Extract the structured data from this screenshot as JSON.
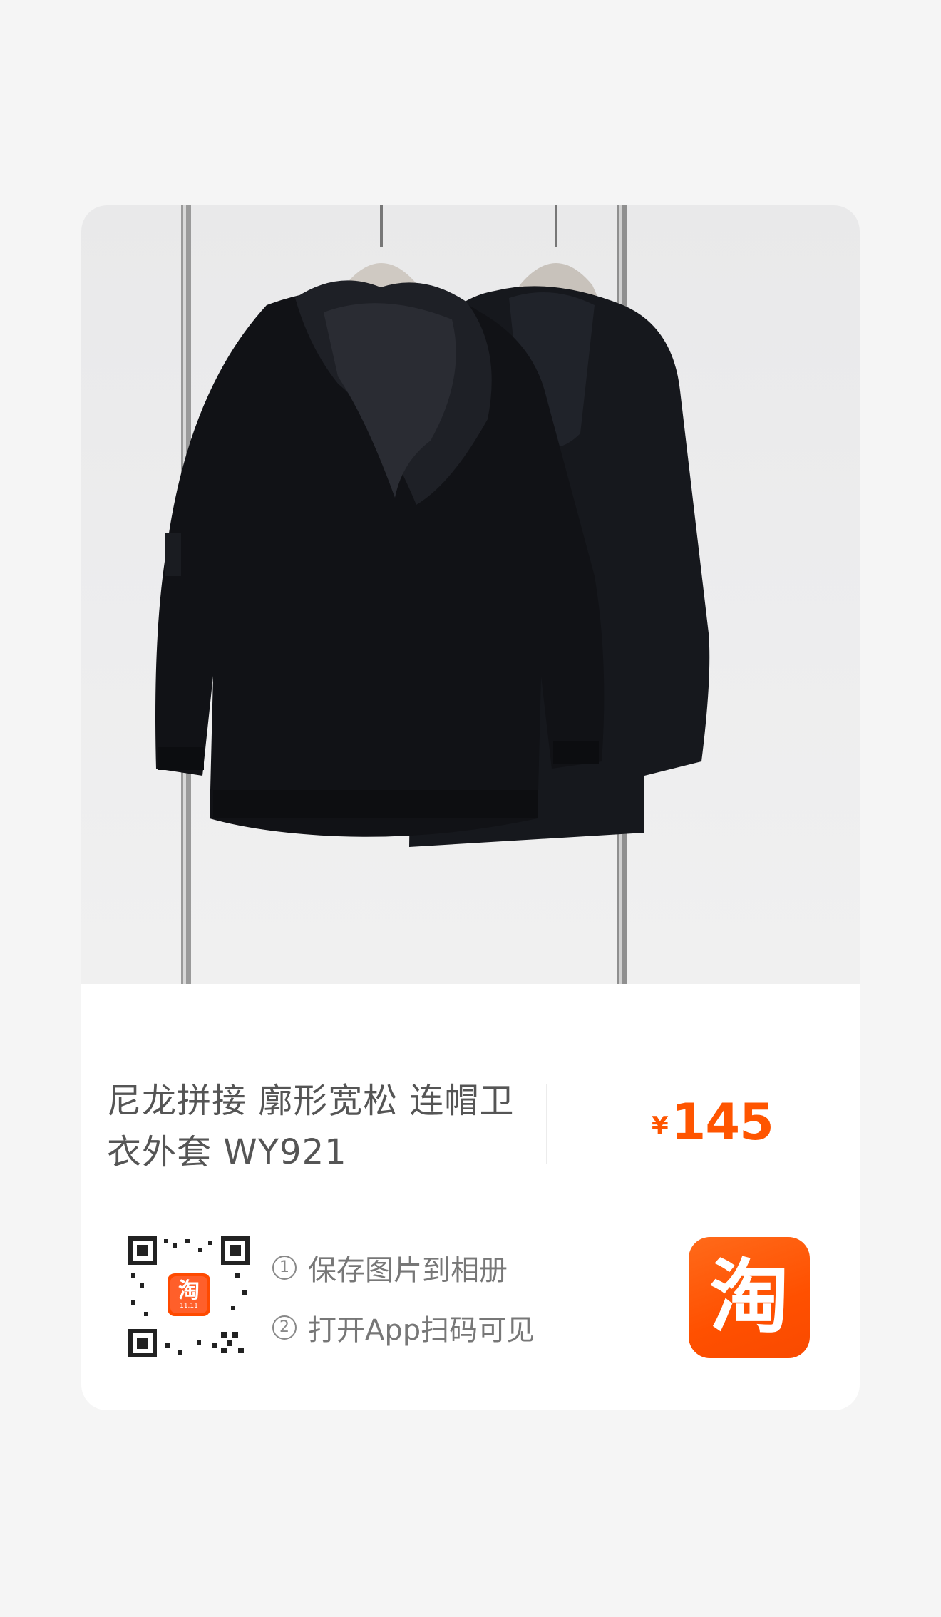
{
  "product": {
    "title_line1": "尼龙拼接 廓形宽松 连帽卫",
    "title_line2": "衣外套 WY921",
    "price_symbol": "¥",
    "price": "145",
    "price_color": "#ff5500"
  },
  "qr": {
    "badge_text": "淘",
    "badge_sub": "11.11"
  },
  "steps": [
    {
      "num": "1",
      "label": "保存图片到相册"
    },
    {
      "num": "2",
      "label": "打开App扫码可见"
    }
  ],
  "logo": {
    "text": "淘",
    "color": "#ff5000"
  }
}
